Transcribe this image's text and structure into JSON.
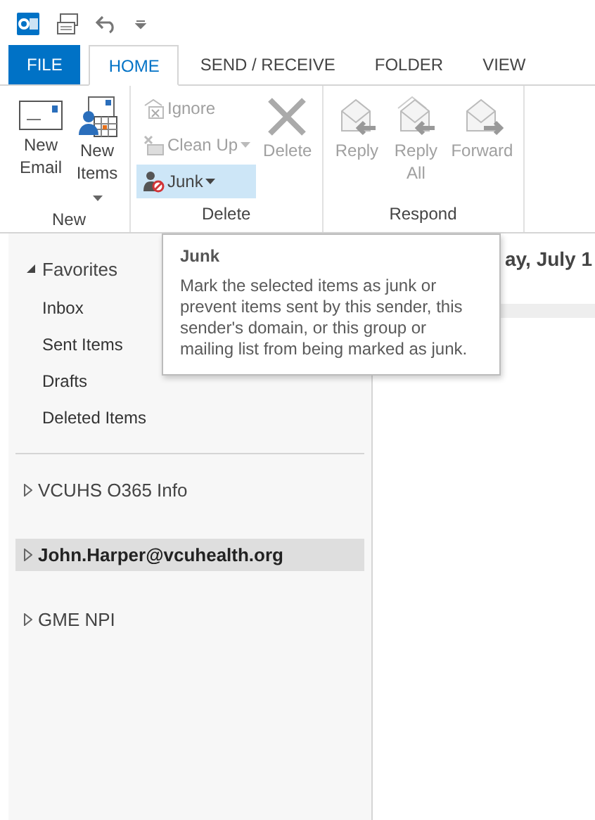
{
  "tabs": [
    {
      "label": "FILE",
      "kind": "file",
      "selected": false
    },
    {
      "label": "HOME",
      "kind": "normal",
      "selected": true
    },
    {
      "label": "SEND / RECEIVE",
      "kind": "normal",
      "selected": false
    },
    {
      "label": "FOLDER",
      "kind": "normal",
      "selected": false
    },
    {
      "label": "VIEW",
      "kind": "normal",
      "selected": false
    }
  ],
  "ribbon_groups": [
    {
      "label": "New",
      "buttons": [
        {
          "label": "New Email",
          "kind": "large",
          "disabled": false,
          "highlighted": false,
          "dropdown": false
        },
        {
          "label": "New Items",
          "kind": "large",
          "disabled": false,
          "highlighted": false,
          "dropdown": true
        }
      ]
    },
    {
      "label": "Delete",
      "buttons": [
        {
          "label": "Ignore",
          "kind": "small",
          "disabled": true,
          "highlighted": false,
          "dropdown": false
        },
        {
          "label": "Clean Up",
          "kind": "small",
          "disabled": true,
          "highlighted": false,
          "dropdown": true
        },
        {
          "label": "Junk",
          "kind": "small",
          "disabled": false,
          "highlighted": true,
          "dropdown": true
        },
        {
          "label": "Delete",
          "kind": "large",
          "disabled": true,
          "highlighted": false,
          "dropdown": false
        }
      ]
    },
    {
      "label": "Respond",
      "buttons": [
        {
          "label": "Reply",
          "kind": "large",
          "disabled": true,
          "highlighted": false,
          "dropdown": false
        },
        {
          "label": "Reply All",
          "kind": "large",
          "disabled": true,
          "highlighted": false,
          "dropdown": false
        },
        {
          "label": "Forward",
          "kind": "large",
          "disabled": true,
          "highlighted": false,
          "dropdown": false
        }
      ]
    }
  ],
  "tooltip": {
    "title": "Junk",
    "body": "Mark the selected items as junk or prevent items sent by this sender, this sender's domain, or this group or mailing list from being marked as junk."
  },
  "favorites": {
    "label": "Favorites",
    "expanded": true,
    "items": [
      "Inbox",
      "Sent Items",
      "Drafts",
      "Deleted Items"
    ]
  },
  "accounts": [
    {
      "label": "VCUHS O365 Info",
      "selected": false,
      "expanded": false
    },
    {
      "label": "John.Harper@vcuhealth.org",
      "selected": true,
      "expanded": false
    },
    {
      "label": "GME NPI",
      "selected": false,
      "expanded": false
    }
  ],
  "message_list": {
    "header": "ay, July 1"
  }
}
